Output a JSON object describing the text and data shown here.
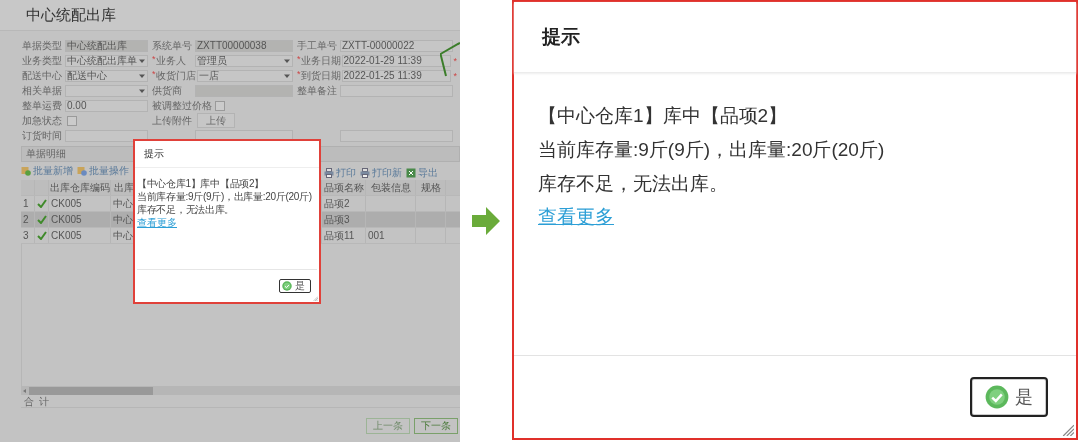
{
  "form_page": {
    "title": "中心统配出库",
    "form_rows": [
      [
        {
          "label": "单据类型",
          "kind": "readonly",
          "value": "中心统配出库"
        },
        {
          "label": "系统单号",
          "kind": "readonly",
          "value": "ZXTT00000038"
        },
        {
          "label": "手工单号",
          "kind": "text",
          "value": "ZXTT-00000022"
        }
      ],
      [
        {
          "label": "业务类型",
          "kind": "select",
          "value": "中心统配出库单"
        },
        {
          "label": "业务人",
          "kind": "select",
          "value": "管理员",
          "required_mark": "*"
        },
        {
          "label": "业务日期",
          "kind": "text",
          "value": "2022-01-29 11:39",
          "required_mark": "*",
          "after_mark": "*"
        }
      ],
      [
        {
          "label": "配送中心",
          "kind": "select",
          "value": "配送中心"
        },
        {
          "label": "收货门店",
          "kind": "select",
          "value": "一店",
          "required_mark": "*"
        },
        {
          "label": "到货日期",
          "kind": "text",
          "value": "2022-01-25 11:39",
          "required_mark": "*",
          "after_mark": "*"
        }
      ],
      [
        {
          "label": "相关单据",
          "kind": "select"
        },
        {
          "label": "供货商",
          "kind": "readonly"
        },
        {
          "label": "整单备注",
          "kind": "text"
        }
      ],
      [
        {
          "label": "整单运费",
          "kind": "text",
          "value": "0.00"
        },
        {
          "label": "被调整过价格",
          "kind": "checkbox",
          "checked": false
        }
      ],
      [
        {
          "label": "加急状态",
          "kind": "checkbox",
          "checked": false
        },
        {
          "label": "上传附件",
          "kind": "button",
          "value": "上传"
        }
      ],
      [
        {
          "label": "订货时间",
          "kind": "text"
        },
        {
          "kind": "text"
        },
        {
          "kind": "text"
        }
      ]
    ],
    "detail_panel": {
      "title": "单据明细"
    },
    "toolbar_left": [
      "批量新增",
      "批量操作"
    ],
    "toolbar_right": [
      "打印",
      "打印新",
      "导出"
    ],
    "table": {
      "columns": [
        "",
        "",
        "出库仓库编码",
        "出库",
        "品项名称",
        "包装信息",
        "规格",
        ""
      ],
      "rows": [
        {
          "selected": false,
          "status_ok": true,
          "cells": [
            "1",
            "",
            "CK005",
            "中心",
            "品项2",
            "",
            "",
            ""
          ]
        },
        {
          "selected": true,
          "status_ok": true,
          "cells": [
            "2",
            "",
            "CK005",
            "中心",
            "品项3",
            "",
            "",
            ""
          ]
        },
        {
          "selected": false,
          "status_ok": true,
          "cells": [
            "3",
            "",
            "CK005",
            "中心",
            "品项11",
            "001",
            "",
            ""
          ]
        }
      ]
    },
    "total_row": [
      "合",
      "计"
    ],
    "nav_buttons": [
      {
        "label": "上一条",
        "disabled": true
      },
      {
        "label": "下一条",
        "disabled": false
      }
    ]
  },
  "dialogs": [
    {
      "title": "提示",
      "lines": [
        "【中心仓库1】库中【品项2】",
        "当前库存量:9斤(9斤)，出库量:20斤(20斤)",
        "库存不足，无法出库。"
      ],
      "link": "查看更多",
      "button": "是"
    },
    {
      "title": "提示",
      "lines": [
        "【中心仓库1】库中【品项2】",
        "当前库存量:9斤(9斤)，出库量:20斤(20斤)",
        "库存不足，无法出库。"
      ],
      "link": "查看更多",
      "button": "是"
    }
  ]
}
